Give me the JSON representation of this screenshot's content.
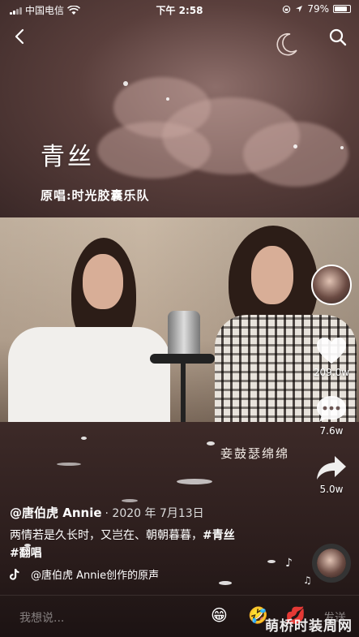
{
  "status_bar": {
    "carrier": "中国电信",
    "time": "下午 2:58",
    "battery": "79%"
  },
  "artwork": {
    "title": "青丝",
    "credit": "原唱:时光胶囊乐队",
    "lyric_overlay": "妾鼓瑟绵绵"
  },
  "actions": {
    "likes": "209.0w",
    "comments": "7.6w",
    "shares": "5.0w"
  },
  "post": {
    "author": "@唐伯虎 Annie",
    "date": "· 2020 年 7月13日",
    "desc_text": "两情若是久长时，又岂在、朝朝暮暮，",
    "tag1": "#青丝",
    "tag2": "#翻唱",
    "music": "@唐伯虎 Annie创作的原声"
  },
  "comment_bar": {
    "placeholder": "我想说...",
    "send": "发送",
    "emojis": [
      "😁",
      "🤣",
      "💋"
    ]
  },
  "watermark": "萌桥时装周网",
  "icons": {
    "back": "chevron-left-icon",
    "search": "search-icon",
    "like": "heart-icon",
    "comment": "comment-bubble-icon",
    "share": "share-arrow-icon",
    "music": "tiktok-note-icon"
  }
}
